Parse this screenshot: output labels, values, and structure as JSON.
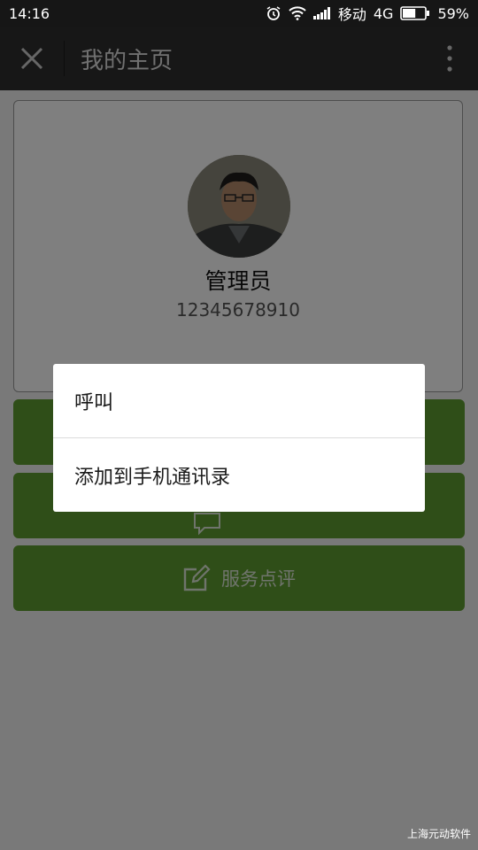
{
  "status_bar": {
    "time": "14:16",
    "carrier": "移动",
    "network": "4G",
    "battery": "59%",
    "battery_level": 0.59,
    "icons": [
      "alarm-icon",
      "wifi-icon",
      "signal-icon",
      "battery-icon"
    ]
  },
  "app_bar": {
    "title": "我的主页",
    "close_icon": "close-icon",
    "more_icon": "more-vertical-icon"
  },
  "profile": {
    "name": "管理员",
    "phone": "12345678910"
  },
  "buttons": [
    {
      "label": "",
      "icon": "phone-icon"
    },
    {
      "label": "",
      "icon": "message-icon"
    },
    {
      "label": "服务点评",
      "icon": "edit-icon"
    }
  ],
  "dialog": {
    "items": [
      "呼叫",
      "添加到手机通讯录"
    ]
  },
  "watermark": "上海元动软件",
  "colors": {
    "accent_green": "#5f9c31",
    "status_bar": "#161616",
    "app_bar": "#2e2e2e"
  }
}
